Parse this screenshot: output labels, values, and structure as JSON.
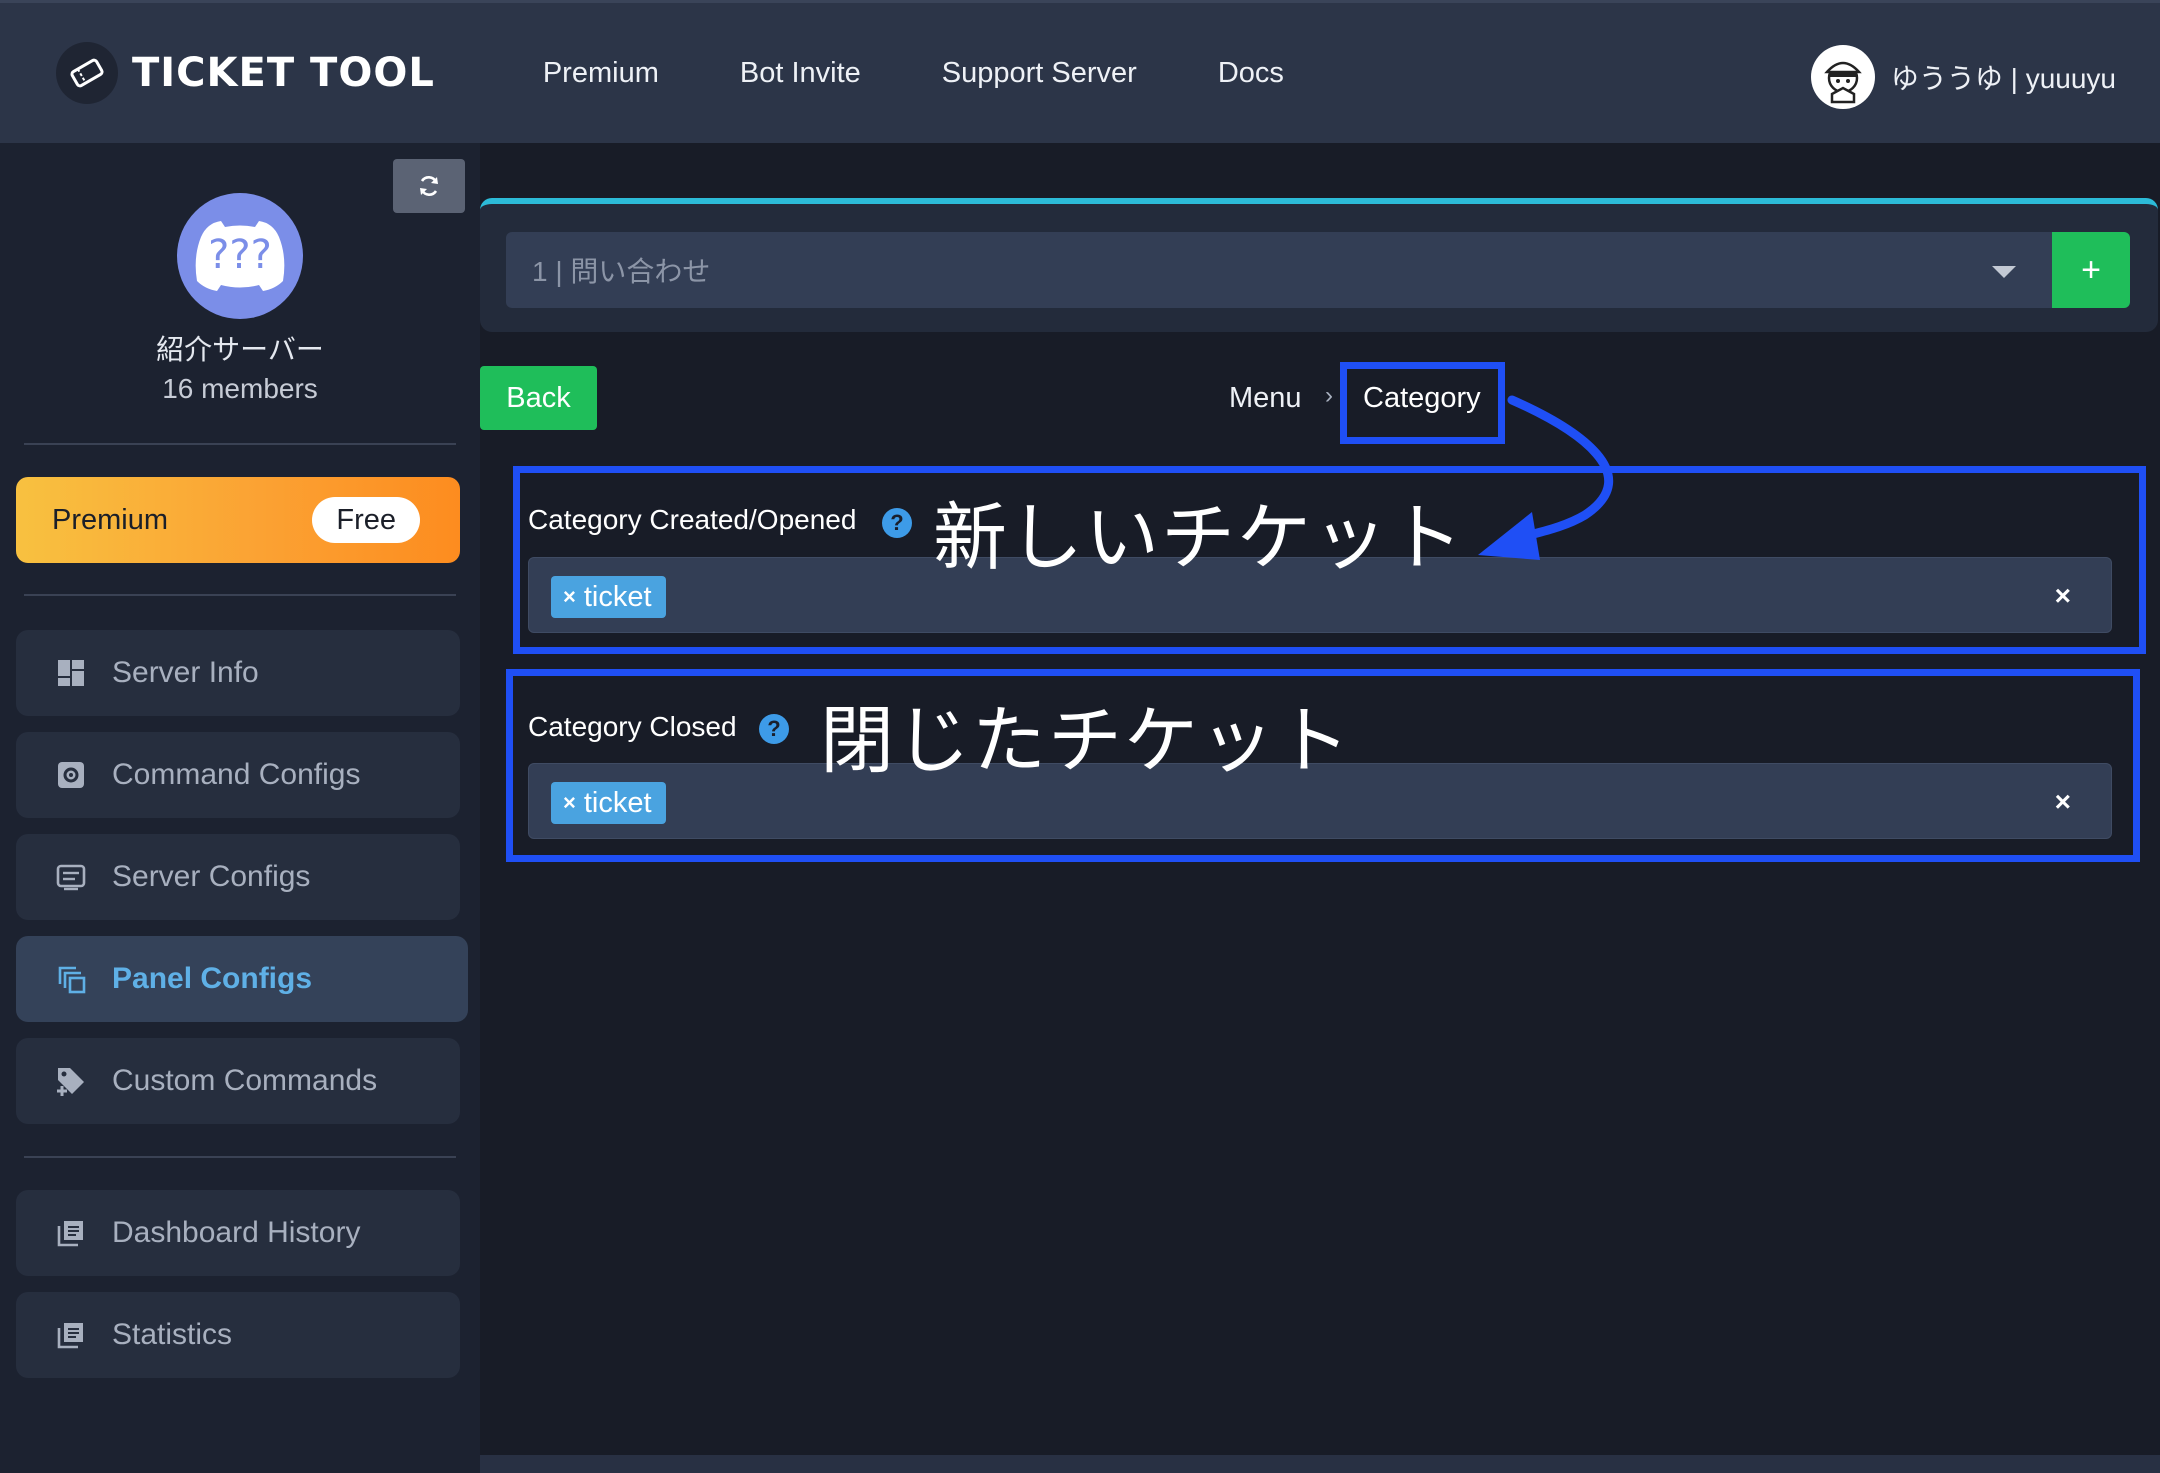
{
  "header": {
    "brand": "TICKET TOOL",
    "nav": [
      "Premium",
      "Bot Invite",
      "Support Server",
      "Docs"
    ],
    "user_name": "ゆううゆ | yuuuyu"
  },
  "sidebar": {
    "server_name": "紹介サーバー",
    "server_avatar_text": "???",
    "members": "16 members",
    "premium_label": "Premium",
    "premium_plan": "Free",
    "items": [
      {
        "label": "Server Info",
        "icon": "dashboard-icon"
      },
      {
        "label": "Command Configs",
        "icon": "gear-box-icon"
      },
      {
        "label": "Server Configs",
        "icon": "server-list-icon"
      },
      {
        "label": "Panel Configs",
        "icon": "copy-panels-icon",
        "active": true
      },
      {
        "label": "Custom Commands",
        "icon": "tag-plus-icon"
      },
      {
        "label": "Dashboard History",
        "icon": "history-list-icon"
      },
      {
        "label": "Statistics",
        "icon": "stats-list-icon"
      }
    ]
  },
  "main": {
    "panel_select_value": "1 | 問い合わせ",
    "add_label": "+",
    "back_label": "Back",
    "breadcrumb": {
      "menu": "Menu",
      "separator": "›",
      "current": "Category"
    },
    "fields": [
      {
        "label": "Category Created/Opened",
        "tag": "ticket",
        "annotation": "新しいチケット"
      },
      {
        "label": "Category Closed",
        "tag": "ticket",
        "annotation": "閉じたチケット"
      }
    ],
    "tag_remove": "×",
    "clear": "×",
    "help": "?"
  },
  "colors": {
    "accent_green": "#1fbe5a",
    "accent_blue": "#4aa3e0",
    "annotation_blue": "#1f4ff5",
    "panel_top_border": "#2cbbd8",
    "premium_gradient_start": "#f8c140",
    "premium_gradient_end": "#fd8c1f"
  }
}
